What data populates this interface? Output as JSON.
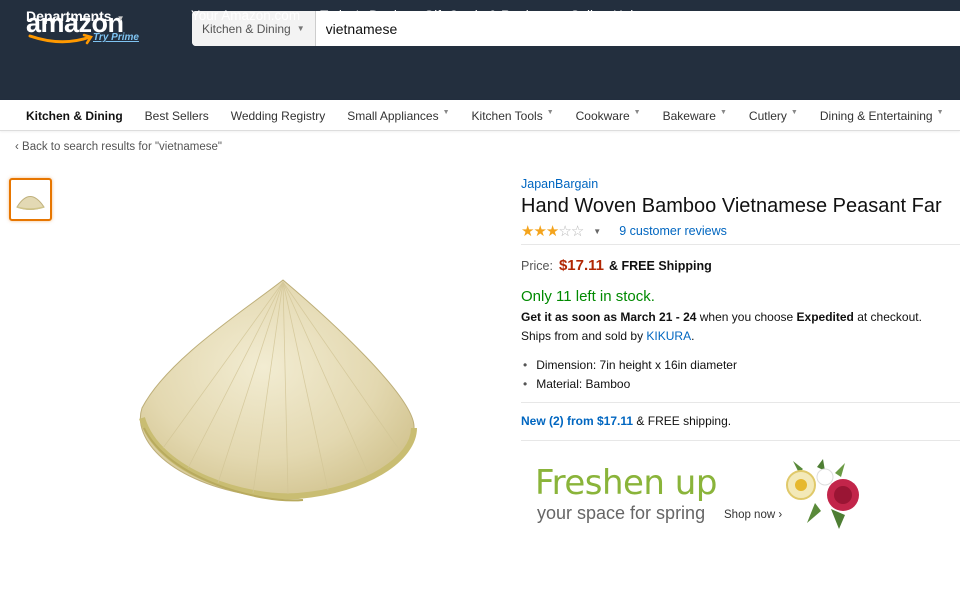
{
  "header": {
    "logo_text": "amazon",
    "logo_prime": "Try Prime",
    "search_category": "Kitchen & Dining",
    "search_value": "vietnamese",
    "departments_label": "Departments",
    "nav_links": [
      "Your Amazon.com",
      "Today's Deals",
      "Gift Cards & Registry",
      "Sell",
      "Help"
    ]
  },
  "subnav": {
    "items": [
      "Kitchen & Dining",
      "Best Sellers",
      "Wedding Registry",
      "Small Appliances",
      "Kitchen Tools",
      "Cookware",
      "Bakeware",
      "Cutlery",
      "Dining & Entertaining"
    ],
    "has_dropdown": [
      false,
      false,
      false,
      true,
      true,
      true,
      true,
      true,
      true
    ]
  },
  "back_link": "Back to search results for \"vietnamese\"",
  "product": {
    "brand": "JapanBargain",
    "title": "Hand Woven Bamboo Vietnamese Peasant Far",
    "rating": 3,
    "rating_max": 5,
    "reviews": "9 customer reviews",
    "price_label": "Price:",
    "price": "$17.11",
    "shipping": "& FREE Shipping",
    "stock": "Only 11 left in stock.",
    "get_it_prefix": "Get it as soon as",
    "get_it_dates": "March 21 - 24",
    "get_it_mid": "when you choose",
    "get_it_method": "Expedited",
    "get_it_suffix": "at checkout.",
    "ships_prefix": "Ships from and sold by",
    "seller": "KIKURA",
    "ships_suffix": ".",
    "bullets": [
      "Dimension: 7in height x 16in diameter",
      "Material: Bamboo"
    ],
    "new_from_link": "New (2) from $17.11",
    "new_from_suffix": "& FREE shipping."
  },
  "ad": {
    "title": "Freshen up",
    "subtitle": "your space for spring",
    "cta": "Shop now"
  },
  "colors": {
    "header_bg": "#232f3e",
    "link": "#0066c0",
    "price": "#b12704",
    "stock": "#008a00",
    "star": "#f4a41d",
    "ad_green": "#8ab43a"
  }
}
